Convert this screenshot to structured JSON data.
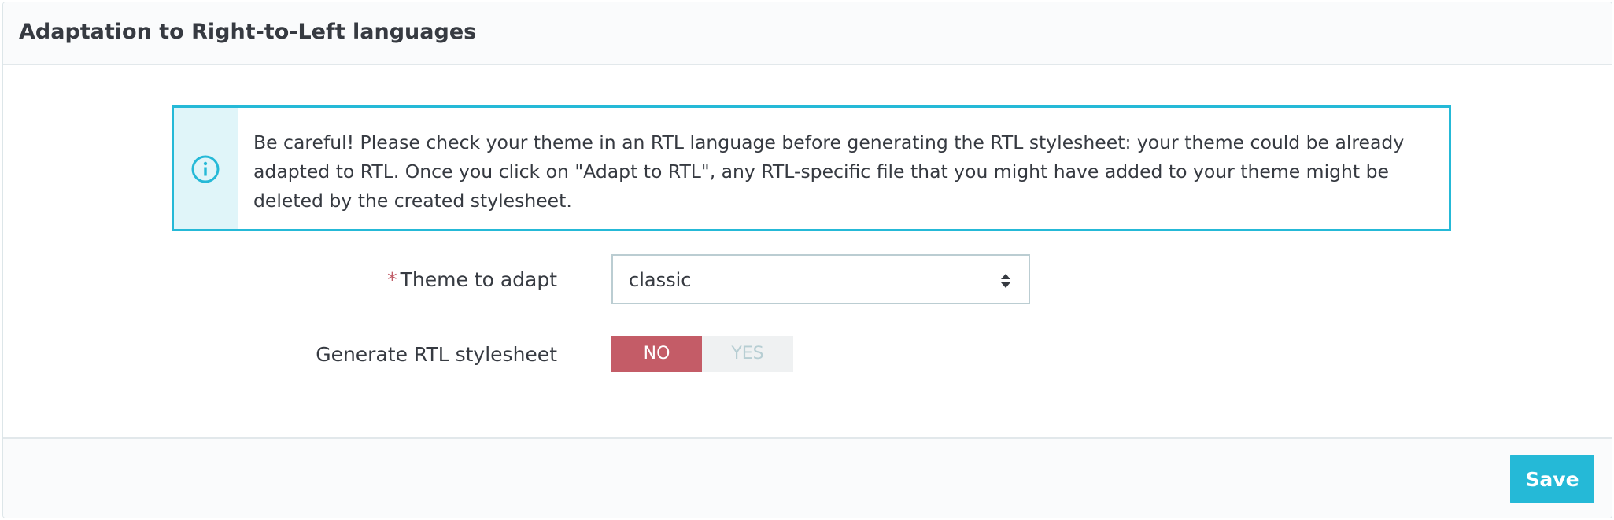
{
  "panel": {
    "title": "Adaptation to Right-to-Left languages"
  },
  "alert": {
    "icon": "info-circle-icon",
    "text": "Be careful! Please check your theme in an RTL language before generating the RTL stylesheet: your theme could be already adapted to RTL. Once you click on \"Adapt to RTL\", any RTL-specific file that you might have added to your theme might be deleted by the created stylesheet."
  },
  "form": {
    "theme": {
      "required_mark": "*",
      "label": "Theme to adapt",
      "selected": "classic"
    },
    "generate_rtl": {
      "label": "Generate RTL stylesheet",
      "no_label": "NO",
      "yes_label": "YES",
      "value": "NO"
    }
  },
  "footer": {
    "save_label": "Save"
  },
  "colors": {
    "accent": "#25b9d7",
    "danger": "#c45c67",
    "alert_bg": "#e0f5f9"
  }
}
